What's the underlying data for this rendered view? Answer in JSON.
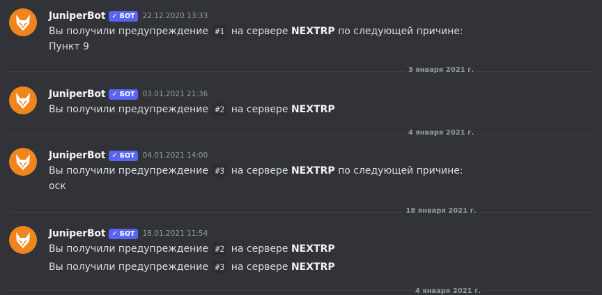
{
  "messages": [
    {
      "username": "JuniperBot",
      "badge": "БОТ",
      "timestamp": "22.12.2020 13:33",
      "lines": [
        {
          "pre": "Вы получили предупреждение",
          "code": "#1",
          "mid": "на сервере",
          "server": "NEXTRP",
          "post": "по следующей причине:"
        },
        {
          "text": "Пункт 9"
        }
      ]
    },
    {
      "username": "JuniperBot",
      "badge": "БОТ",
      "timestamp": "03.01.2021 21:36",
      "lines": [
        {
          "pre": "Вы получили предупреждение",
          "code": "#2",
          "mid": "на сервере",
          "server": "NEXTRP"
        }
      ]
    },
    {
      "username": "JuniperBot",
      "badge": "БОТ",
      "timestamp": "04.01.2021 14:00",
      "lines": [
        {
          "pre": "Вы получили предупреждение",
          "code": "#3",
          "mid": "на сервере",
          "server": "NEXTRP",
          "post": "по следующей причине:"
        },
        {
          "text": "оск"
        }
      ]
    },
    {
      "username": "JuniperBot",
      "badge": "БОТ",
      "timestamp": "18.01.2021 11:54",
      "lines": [
        {
          "pre": "Вы получили предупреждение",
          "code": "#2",
          "mid": "на сервере",
          "server": "NEXTRP"
        },
        {
          "pre": "Вы получили предупреждение",
          "code": "#3",
          "mid": "на сервере",
          "server": "NEXTRP"
        }
      ]
    }
  ],
  "dividers": [
    {
      "label": "3 января 2021 г."
    },
    {
      "label": "4 января 2021 г."
    },
    {
      "label": "18 января 2021 г."
    },
    {
      "label": "4 января 2021 г."
    }
  ],
  "icons": {
    "avatar": "fox-avatar-icon",
    "badge_check": "check-icon"
  },
  "colors": {
    "background": "#313338",
    "badge": "#5865f2",
    "avatar": "#f0851e"
  }
}
